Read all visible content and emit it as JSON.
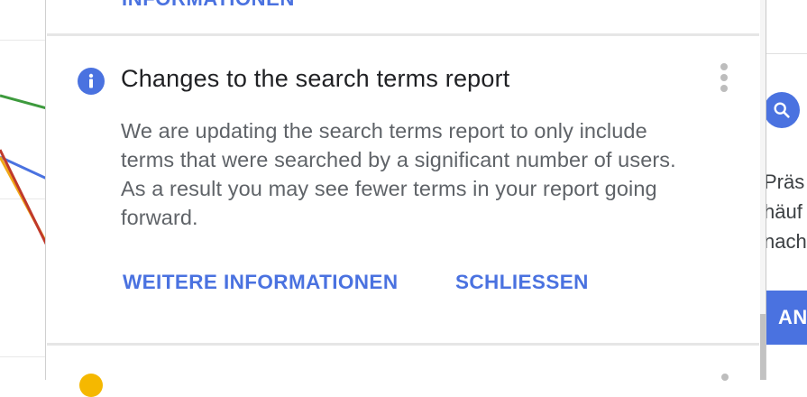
{
  "top_link": {
    "label": "INFORMATIONEN"
  },
  "card": {
    "icon": "info-icon",
    "title": "Changes to the search terms report",
    "body": "We are updating the search terms report to only include terms that were searched by a significant number of users. As a result you may see fewer terms in your report going forward.",
    "more_icon": "more-vertical-icon",
    "actions": {
      "learn_more": "WEITERE INFORMATIONEN",
      "dismiss": "SCHLIESSEN"
    }
  },
  "background_right": {
    "search_icon": "search-icon",
    "text_lines": [
      "Präs",
      "häuf",
      "nach"
    ],
    "button_label": "AN"
  },
  "colors": {
    "accent": "#4a72e0",
    "title_text": "#202124",
    "body_text": "#5f6368",
    "chart_green": "#3d9a3d",
    "chart_blue": "#4a72e0",
    "chart_orange": "#f0a818",
    "chart_red": "#c0392b"
  }
}
